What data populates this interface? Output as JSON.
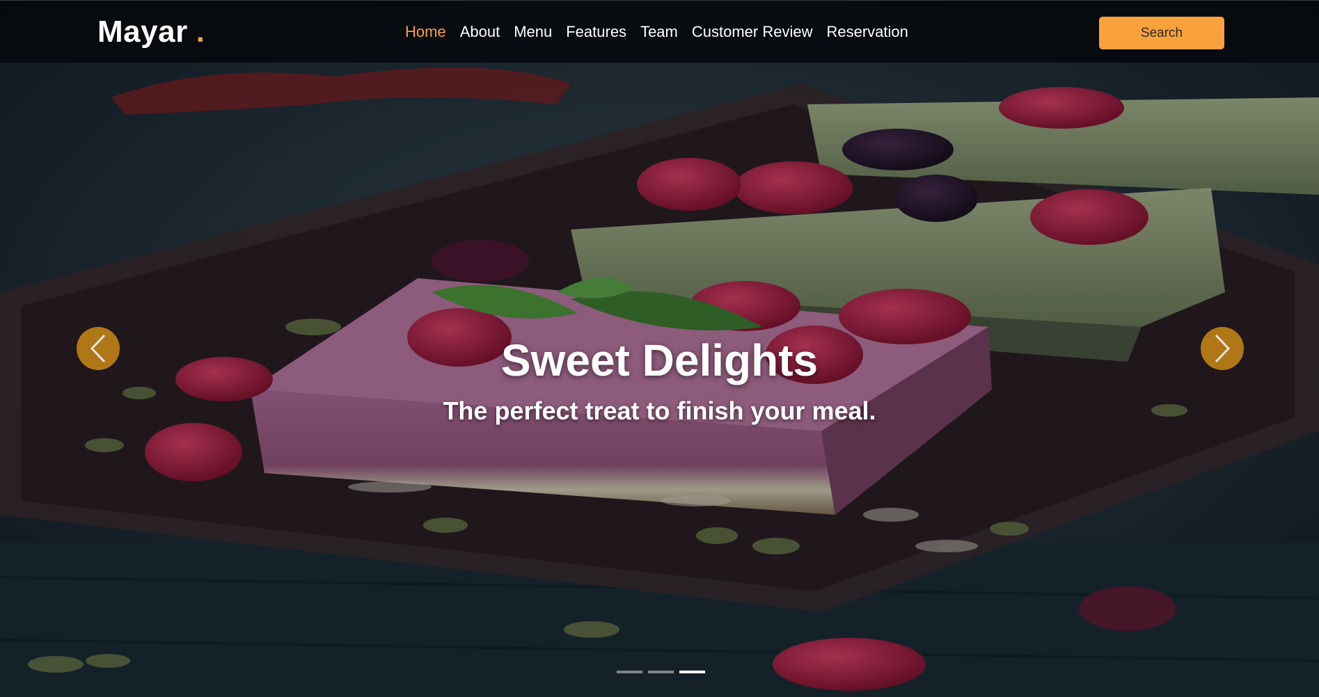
{
  "brand": {
    "name": "Mayar",
    "dot": ".",
    "accent_color": "#f9a13a"
  },
  "nav": {
    "items": [
      {
        "label": "Home",
        "active": true
      },
      {
        "label": "About",
        "active": false
      },
      {
        "label": "Menu",
        "active": false
      },
      {
        "label": "Features",
        "active": false
      },
      {
        "label": "Team",
        "active": false
      },
      {
        "label": "Customer Review",
        "active": false
      },
      {
        "label": "Reservation",
        "active": false
      }
    ],
    "search_label": "Search"
  },
  "slide": {
    "title": "Sweet Delights",
    "subtitle": "The perfect treat to finish your meal."
  },
  "carousel": {
    "prev_icon": "chevron-left-icon",
    "next_icon": "chevron-right-icon",
    "slide_count": 3,
    "active_index": 2
  }
}
